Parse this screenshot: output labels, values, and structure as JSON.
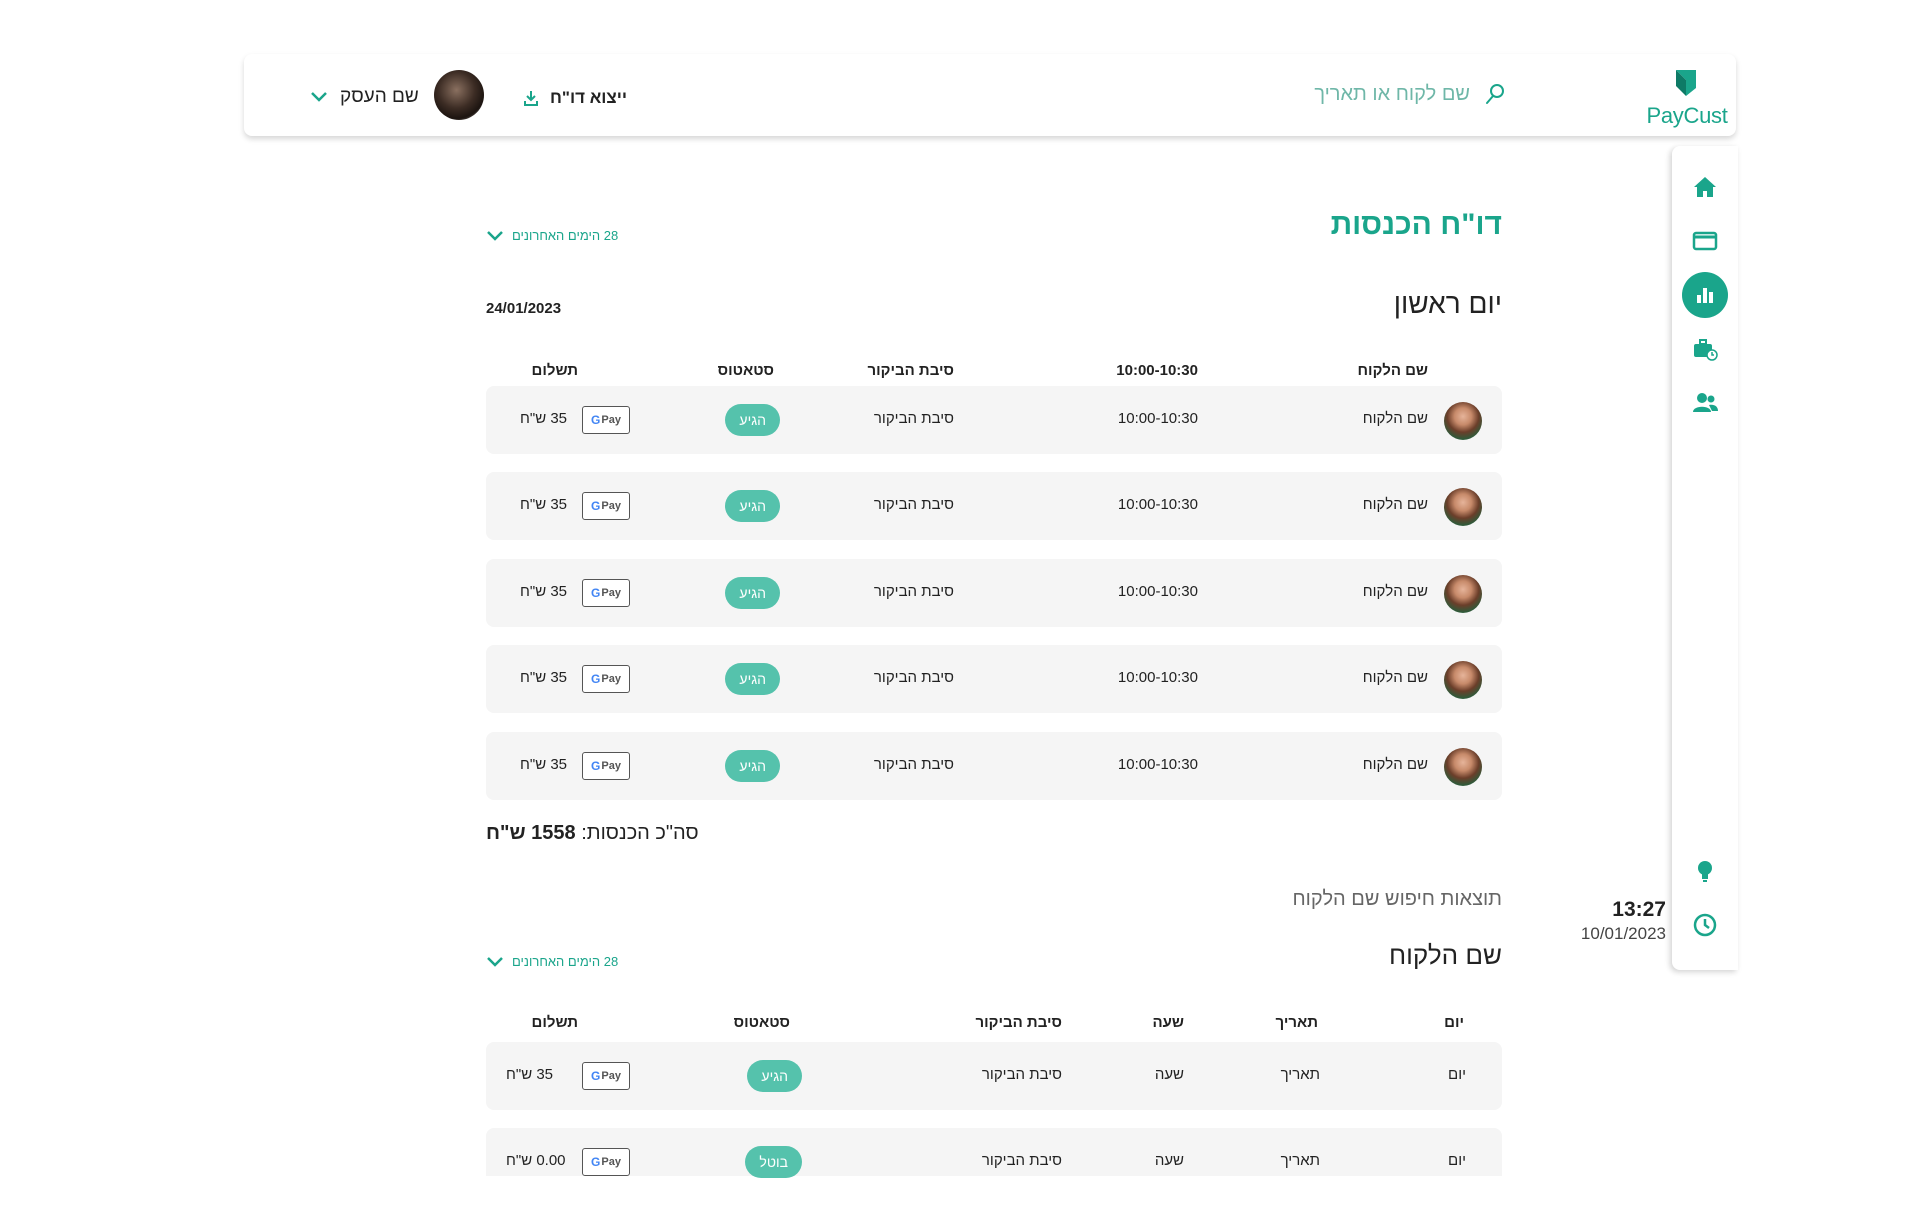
{
  "header": {
    "logo_text": "PayCust",
    "search_placeholder": "שם לקוח או תאריך",
    "export_label": "ייצוא דו\"ח",
    "business_name": "שם העסק"
  },
  "sidebar": {
    "items": [
      {
        "icon": "home-icon",
        "active": false
      },
      {
        "icon": "window-icon",
        "active": false
      },
      {
        "icon": "bar-chart-icon",
        "active": true
      },
      {
        "icon": "briefcase-clock-icon",
        "active": false
      },
      {
        "icon": "users-icon",
        "active": false
      },
      {
        "icon": "lightbulb-icon",
        "active": false
      },
      {
        "icon": "clock-icon",
        "active": false
      }
    ]
  },
  "clock": {
    "time": "13:27",
    "date": "10/01/2023"
  },
  "report": {
    "title": "דו\"ח הכנסות",
    "range_label": "28 הימים האחרונים",
    "day_title": "יום ראשון",
    "day_date": "24/01/2023",
    "columns": {
      "customer": "שם הלקוח",
      "time": "10:00-10:30",
      "reason": "סיבת הביקור",
      "status": "סטאטוס",
      "payment": "תשלום"
    },
    "rows": [
      {
        "customer": "שם הלקוח",
        "time": "10:00-10:30",
        "reason": "סיבת הביקור",
        "status": "הגיע",
        "payment": "35 ש\"ח"
      },
      {
        "customer": "שם הלקוח",
        "time": "10:00-10:30",
        "reason": "סיבת הביקור",
        "status": "הגיע",
        "payment": "35 ש\"ח"
      },
      {
        "customer": "שם הלקוח",
        "time": "10:00-10:30",
        "reason": "סיבת הביקור",
        "status": "הגיע",
        "payment": "35 ש\"ח"
      },
      {
        "customer": "שם הלקוח",
        "time": "10:00-10:30",
        "reason": "סיבת הביקור",
        "status": "הגיע",
        "payment": "35 ש\"ח"
      },
      {
        "customer": "שם הלקוח",
        "time": "10:00-10:30",
        "reason": "סיבת הביקור",
        "status": "הגיע",
        "payment": "35 ש\"ח"
      }
    ],
    "total_label": "סה\"כ הכנסות:",
    "total_value": "1558 ש\"ח"
  },
  "search_results": {
    "label": "תוצאות חיפוש שם הלקוח",
    "customer_title": "שם הלקוח",
    "range_label": "28 הימים האחרונים",
    "columns": {
      "day": "יום",
      "date": "תאריך",
      "hour": "שעה",
      "reason": "סיבת הביקור",
      "status": "סטאטוס",
      "payment": "תשלום"
    },
    "rows": [
      {
        "day": "יום",
        "date": "תאריך",
        "hour": "שעה",
        "reason": "סיבת הביקור",
        "status": "הגיע",
        "payment": "35 ש\"ח"
      },
      {
        "day": "יום",
        "date": "תאריך",
        "hour": "שעה",
        "reason": "סיבת הביקור",
        "status": "בוטל",
        "payment": "0.00 ש\"ח"
      }
    ]
  },
  "payment_method": "G Pay",
  "colors": {
    "accent": "#1aa58b",
    "badge": "#55c2ac",
    "row_bg": "#f5f5f5"
  }
}
